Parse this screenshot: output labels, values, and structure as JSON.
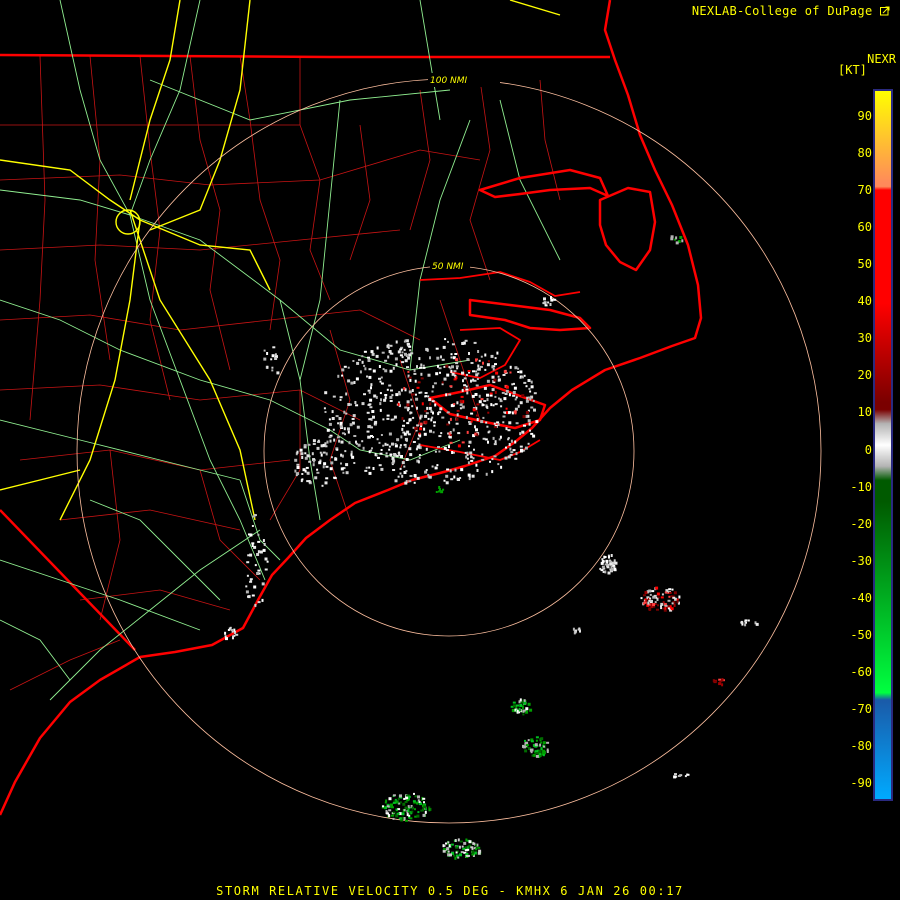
{
  "header": {
    "credit": "NEXLAB-College of DuPage",
    "credit_icon": "external-link-icon"
  },
  "legend": {
    "product": "NEXR",
    "unit": "[KT]",
    "ticks": [
      "90",
      "80",
      "70",
      "60",
      "50",
      "40",
      "30",
      "20",
      "10",
      "0",
      "-10",
      "-20",
      "-30",
      "-40",
      "-50",
      "-60",
      "-70",
      "-80",
      "-90"
    ],
    "range": [
      -95,
      95
    ],
    "colors": {
      "ramp_top": "#ffff00",
      "orange": "#ff8a5a",
      "red": "#ff0000",
      "dark_red": "#7a0000",
      "gray": "#b4b4b4",
      "dark_green": "#005a00",
      "green": "#00ff40",
      "dark_blue": "#1a5aa8",
      "light_blue": "#00aaff"
    }
  },
  "map": {
    "range_rings": [
      {
        "label": "50 NMI"
      },
      {
        "label": "100 NMI"
      }
    ],
    "colors": {
      "coast": "#ff0000",
      "county": "#c81414",
      "roads": "#90ee90",
      "interstates": "#ffff00",
      "rings": "#ffc0a0"
    }
  },
  "footer": {
    "caption": "STORM RELATIVE VELOCITY 0.5 DEG - KMHX 6 JAN 26 00:17"
  }
}
